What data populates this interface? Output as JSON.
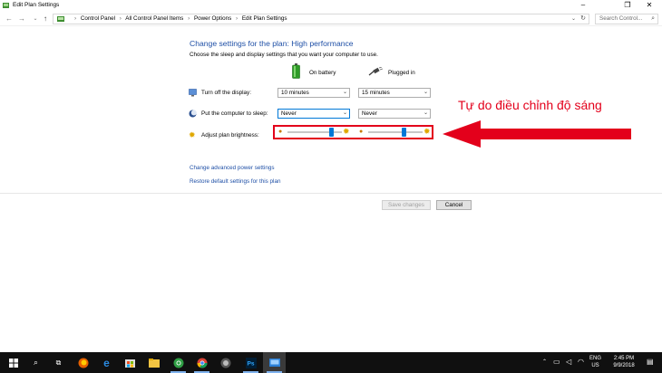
{
  "window": {
    "title": "Edit Plan Settings",
    "minimize_glyph": "–",
    "maximize_glyph": "❐",
    "close_glyph": "✕"
  },
  "address_bar": {
    "breadcrumbs": [
      "Control Panel",
      "All Control Panel Items",
      "Power Options",
      "Edit Plan Settings"
    ],
    "search_placeholder": "Search Control..."
  },
  "main": {
    "heading": "Change settings for the plan: High performance",
    "subheading": "Choose the sleep and display settings that you want your computer to use.",
    "columns": {
      "battery": "On battery",
      "plugged": "Plugged in"
    },
    "rows": {
      "display": {
        "label": "Turn off the display:",
        "battery": "10 minutes",
        "plugged": "15 minutes"
      },
      "sleep": {
        "label": "Put the computer to sleep:",
        "battery": "Never",
        "plugged": "Never"
      },
      "brightness": {
        "label": "Adjust plan brightness:",
        "battery_level": 0.8,
        "plugged_level": 0.65
      }
    },
    "links": {
      "advanced": "Change advanced power settings",
      "restore": "Restore default settings for this plan"
    },
    "buttons": {
      "save": "Save changes",
      "cancel": "Cancel"
    }
  },
  "annotation": {
    "text": "Tự do điều chỉnh độ sáng",
    "color": "#e3001b"
  },
  "taskbar": {
    "icons": [
      "windows-start",
      "search",
      "task-view",
      "firefox",
      "edge",
      "store",
      "folder",
      "chrome-green",
      "chrome",
      "photoshop",
      "wifi-app",
      "control-panel"
    ],
    "tray": {
      "lang": "ENG",
      "region": "US",
      "time": "2:45 PM",
      "date": "9/9/2018"
    }
  }
}
